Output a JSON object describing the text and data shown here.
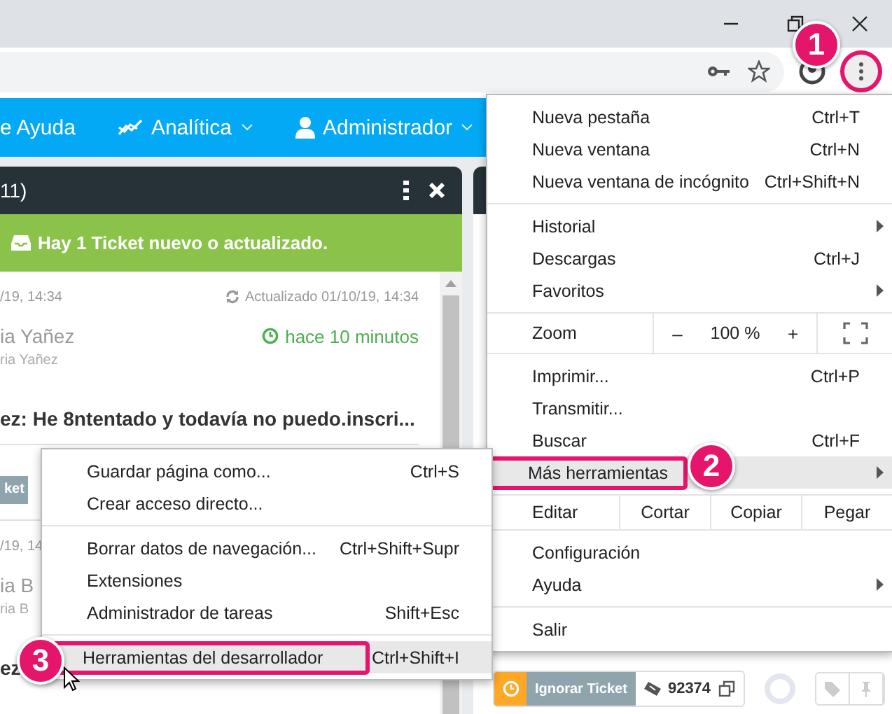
{
  "toolbar": {
    "menu_button": {
      "annotated": true
    }
  },
  "nav": {
    "items": [
      {
        "label": "e Ayuda",
        "dropdown": false
      },
      {
        "label": "Analítica",
        "dropdown": true
      },
      {
        "label": "Administrador",
        "dropdown": true
      }
    ]
  },
  "panel": {
    "title": "11)",
    "notice": "Hay 1 Ticket nuevo o actualizado.",
    "tickets": [
      {
        "created": "/19, 14:34",
        "updated": "Actualizado 01/10/19, 14:34",
        "author": "ia Yañez",
        "age": "hace 10 minutos",
        "subauthor": "ria Yañez",
        "subject": "ez: He 8ntentado y todavía no puedo.inscri...",
        "action": "ket"
      },
      {
        "created": "/19, 14",
        "author": "ia B",
        "subauthor": "ria B",
        "subject": "ez"
      }
    ]
  },
  "right_panel": {
    "footer": {
      "ignore_label": "Ignorar Ticket",
      "ticket_number": "92374"
    }
  },
  "main_menu": {
    "sections": [
      [
        {
          "kind": "item",
          "label": "Nueva pestaña",
          "shortcut": "Ctrl+T",
          "submenu": false,
          "selected": false
        },
        {
          "kind": "item",
          "label": "Nueva ventana",
          "shortcut": "Ctrl+N",
          "submenu": false,
          "selected": false
        },
        {
          "kind": "item",
          "label": "Nueva ventana de incógnito",
          "shortcut": "Ctrl+Shift+N",
          "submenu": false,
          "selected": false
        }
      ],
      [
        {
          "kind": "item",
          "label": "Historial",
          "submenu": true,
          "selected": false
        },
        {
          "kind": "item",
          "label": "Descargas",
          "shortcut": "Ctrl+J",
          "submenu": false,
          "selected": false
        },
        {
          "kind": "item",
          "label": "Favoritos",
          "submenu": true,
          "selected": false
        }
      ],
      [
        {
          "kind": "zoom",
          "label": "Zoom",
          "minus": "–",
          "value": "100 %",
          "plus": "+"
        }
      ],
      [
        {
          "kind": "item",
          "label": "Imprimir...",
          "shortcut": "Ctrl+P",
          "submenu": false,
          "selected": false
        },
        {
          "kind": "item",
          "label": "Transmitir...",
          "submenu": false,
          "selected": false
        },
        {
          "kind": "item",
          "label": "Buscar",
          "shortcut": "Ctrl+F",
          "submenu": false,
          "selected": false
        },
        {
          "kind": "item",
          "label": "Más herramientas",
          "submenu": true,
          "selected": true
        }
      ],
      [
        {
          "kind": "edit",
          "label": "Editar",
          "actions": [
            "Cortar",
            "Copiar",
            "Pegar"
          ]
        }
      ],
      [
        {
          "kind": "item",
          "label": "Configuración",
          "submenu": false,
          "selected": false
        },
        {
          "kind": "item",
          "label": "Ayuda",
          "submenu": true,
          "selected": false
        }
      ],
      [
        {
          "kind": "item",
          "label": "Salir",
          "submenu": false,
          "selected": false
        }
      ]
    ]
  },
  "sub_menu": {
    "sections": [
      [
        {
          "kind": "item",
          "label": "Guardar página como...",
          "shortcut": "Ctrl+S",
          "submenu": false,
          "selected": false
        },
        {
          "kind": "item",
          "label": "Crear acceso directo...",
          "submenu": false,
          "selected": false
        }
      ],
      [
        {
          "kind": "item",
          "label": "Borrar datos de navegación...",
          "shortcut": "Ctrl+Shift+Supr",
          "submenu": false,
          "selected": false
        },
        {
          "kind": "item",
          "label": "Extensiones",
          "submenu": false,
          "selected": false
        },
        {
          "kind": "item",
          "label": "Administrador de tareas",
          "shortcut": "Shift+Esc",
          "submenu": false,
          "selected": false
        }
      ],
      [
        {
          "kind": "item",
          "label": "Herramientas del desarrollador",
          "shortcut": "Ctrl+Shift+I",
          "submenu": false,
          "selected": true
        }
      ]
    ]
  },
  "callouts": [
    {
      "number": "1"
    },
    {
      "number": "2"
    },
    {
      "number": "3"
    }
  ]
}
